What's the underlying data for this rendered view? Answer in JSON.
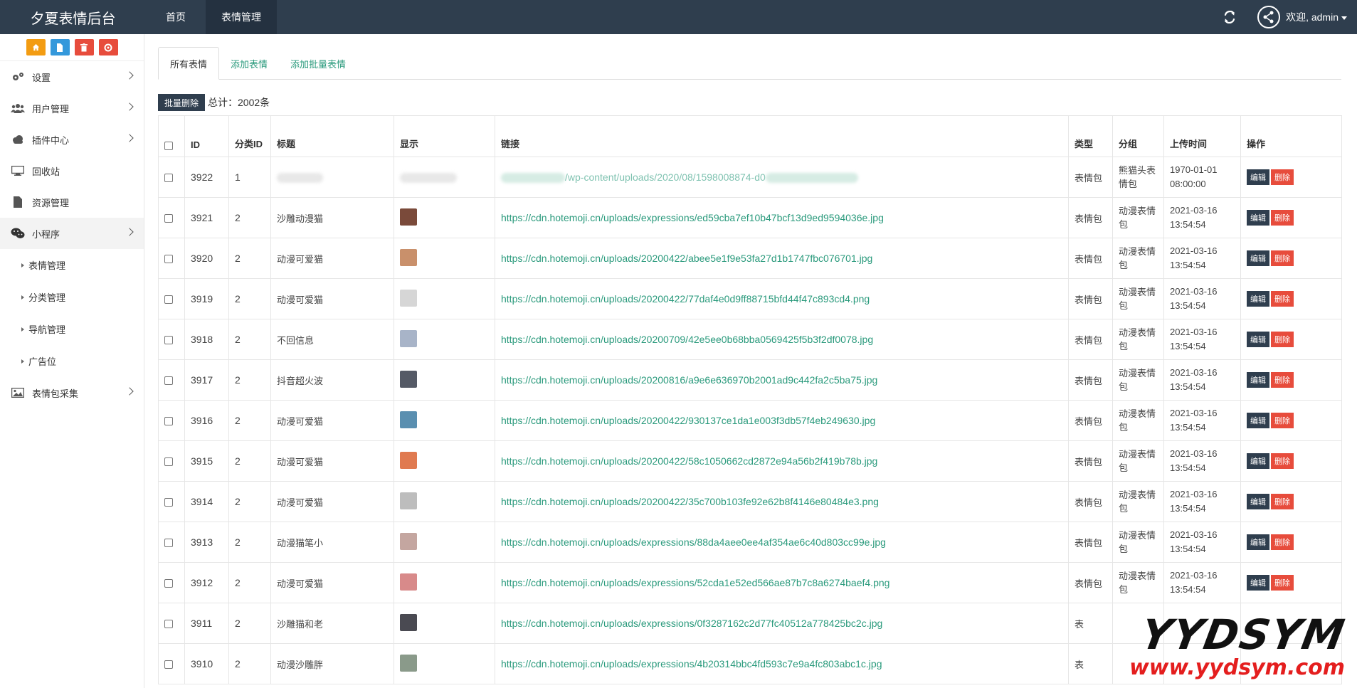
{
  "brand": "夕夏表情后台",
  "nav": {
    "home": "首页",
    "expression": "表情管理"
  },
  "user": {
    "welcome": "欢迎, admin"
  },
  "sidebar": {
    "items": [
      {
        "label": "设置"
      },
      {
        "label": "用户管理"
      },
      {
        "label": "插件中心"
      },
      {
        "label": "回收站"
      },
      {
        "label": "资源管理"
      },
      {
        "label": "小程序"
      },
      {
        "label": "表情包采集"
      }
    ],
    "subitems": [
      {
        "label": "表情管理"
      },
      {
        "label": "分类管理"
      },
      {
        "label": "导航管理"
      },
      {
        "label": "广告位"
      }
    ]
  },
  "tabs": [
    "所有表情",
    "添加表情",
    "添加批量表情"
  ],
  "toolbar": {
    "batch_delete": "批量删除",
    "total": "总计：2002条"
  },
  "table": {
    "headers": {
      "id": "ID",
      "cat_id": "分类ID",
      "title": "标题",
      "display": "显示",
      "link": "链接",
      "type": "类型",
      "group": "分组",
      "time": "上传时间",
      "ops": "操作"
    },
    "first_row": {
      "id": "3922",
      "cat": "1",
      "link_partial": "/wp-content/uploads/2020/08/1598008874-d0",
      "type": "表情包",
      "group": "熊猫头表情包",
      "time": "1970-01-01 08:00:00"
    },
    "rows": [
      {
        "id": "3921",
        "cat": "2",
        "title": "沙雕动漫猫",
        "link": "https://cdn.hotemoji.cn/uploads/expressions/ed59cba7ef10b47bcf13d9ed9594036e.jpg",
        "type": "表情包",
        "group": "动漫表情包",
        "time": "2021-03-16 13:54:54",
        "thumb": "#7a4a3a"
      },
      {
        "id": "3920",
        "cat": "2",
        "title": "动漫可爱猫",
        "link": "https://cdn.hotemoji.cn/uploads/20200422/abee5e1f9e53fa27d1b1747fbc076701.jpg",
        "type": "表情包",
        "group": "动漫表情包",
        "time": "2021-03-16 13:54:54",
        "thumb": "#c9906b"
      },
      {
        "id": "3919",
        "cat": "2",
        "title": "动漫可爱猫",
        "link": "https://cdn.hotemoji.cn/uploads/20200422/77daf4e0d9ff88715bfd44f47c893cd4.png",
        "type": "表情包",
        "group": "动漫表情包",
        "time": "2021-03-16 13:54:54",
        "thumb": "#d6d6d6"
      },
      {
        "id": "3918",
        "cat": "2",
        "title": "不回信息",
        "link": "https://cdn.hotemoji.cn/uploads/20200709/42e5ee0b68bba0569425f5b3f2df0078.jpg",
        "type": "表情包",
        "group": "动漫表情包",
        "time": "2021-03-16 13:54:54",
        "thumb": "#a8b4c8"
      },
      {
        "id": "3917",
        "cat": "2",
        "title": "抖音超火波",
        "link": "https://cdn.hotemoji.cn/uploads/20200816/a9e6e636970b2001ad9c442fa2c5ba75.jpg",
        "type": "表情包",
        "group": "动漫表情包",
        "time": "2021-03-16 13:54:54",
        "thumb": "#555a66"
      },
      {
        "id": "3916",
        "cat": "2",
        "title": "动漫可爱猫",
        "link": "https://cdn.hotemoji.cn/uploads/20200422/930137ce1da1e003f3db57f4eb249630.jpg",
        "type": "表情包",
        "group": "动漫表情包",
        "time": "2021-03-16 13:54:54",
        "thumb": "#5a8fb0"
      },
      {
        "id": "3915",
        "cat": "2",
        "title": "动漫可爱猫",
        "link": "https://cdn.hotemoji.cn/uploads/20200422/58c1050662cd2872e94a56b2f419b78b.jpg",
        "type": "表情包",
        "group": "动漫表情包",
        "time": "2021-03-16 13:54:54",
        "thumb": "#e07a50"
      },
      {
        "id": "3914",
        "cat": "2",
        "title": "动漫可爱猫",
        "link": "https://cdn.hotemoji.cn/uploads/20200422/35c700b103fe92e62b8f4146e80484e3.png",
        "type": "表情包",
        "group": "动漫表情包",
        "time": "2021-03-16 13:54:54",
        "thumb": "#bdbdbd"
      },
      {
        "id": "3913",
        "cat": "2",
        "title": "动漫猫笔小",
        "link": "https://cdn.hotemoji.cn/uploads/expressions/88da4aee0ee4af354ae6c40d803cc99e.jpg",
        "type": "表情包",
        "group": "动漫表情包",
        "time": "2021-03-16 13:54:54",
        "thumb": "#c4a6a0"
      },
      {
        "id": "3912",
        "cat": "2",
        "title": "动漫可爱猫",
        "link": "https://cdn.hotemoji.cn/uploads/expressions/52cda1e52ed566ae87b7c8a6274baef4.png",
        "type": "表情包",
        "group": "动漫表情包",
        "time": "2021-03-16 13:54:54",
        "thumb": "#d88a8a"
      },
      {
        "id": "3911",
        "cat": "2",
        "title": "沙雕猫和老",
        "link": "https://cdn.hotemoji.cn/uploads/expressions/0f3287162c2d77fc40512a778425bc2c.jpg",
        "type": "表",
        "group": "",
        "time": "",
        "thumb": "#4a4a52"
      },
      {
        "id": "3910",
        "cat": "2",
        "title": "动漫沙雕胖",
        "link": "https://cdn.hotemoji.cn/uploads/expressions/4b20314bbc4fd593c7e9a4fc803abc1c.jpg",
        "type": "表",
        "group": "",
        "time": "",
        "thumb": "#8a9a8a"
      }
    ],
    "edit_label": "编辑",
    "delete_label": "删除"
  },
  "watermark": {
    "big": "YYDSYM",
    "small": "www.yydsym.com"
  },
  "colors": {
    "navbar": "#2f3e4e",
    "link": "#2a9a7c",
    "danger": "#e74c3c",
    "orange": "#f39c12",
    "blue": "#3498db"
  }
}
